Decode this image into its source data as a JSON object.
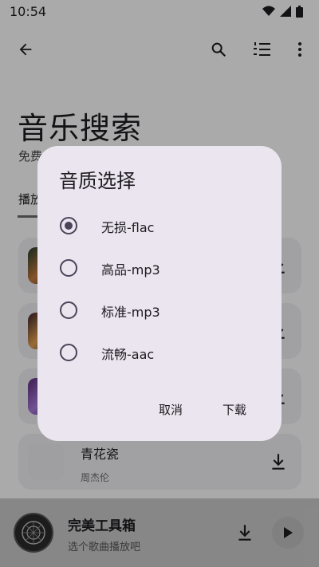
{
  "status_bar": {
    "time": "10:54"
  },
  "header": {
    "title": "音乐搜索",
    "subtitle": "免费",
    "tab": "播放"
  },
  "songs": [
    {
      "title": "",
      "artist": ""
    },
    {
      "title": "",
      "artist": ""
    },
    {
      "title": "",
      "artist": ""
    },
    {
      "title": "青花瓷",
      "artist": "周杰伦"
    }
  ],
  "player": {
    "title": "完美工具箱",
    "subtitle": "选个歌曲播放吧"
  },
  "dialog": {
    "title": "音质选择",
    "options": [
      {
        "label": "无损-flac",
        "checked": true
      },
      {
        "label": "高品-mp3",
        "checked": false
      },
      {
        "label": "标准-mp3",
        "checked": false
      },
      {
        "label": "流畅-aac",
        "checked": false
      }
    ],
    "cancel_label": "取消",
    "ok_label": "下载"
  },
  "icons": {
    "back": "arrow-back-icon",
    "search": "search-icon",
    "list": "numbered-list-icon",
    "more": "more-vert-icon",
    "download": "download-icon",
    "play": "play-icon"
  },
  "colors": {
    "dialog_bg": "#ebe5ef",
    "radio": "#4a4458",
    "card_bg": "#eeecf1"
  }
}
